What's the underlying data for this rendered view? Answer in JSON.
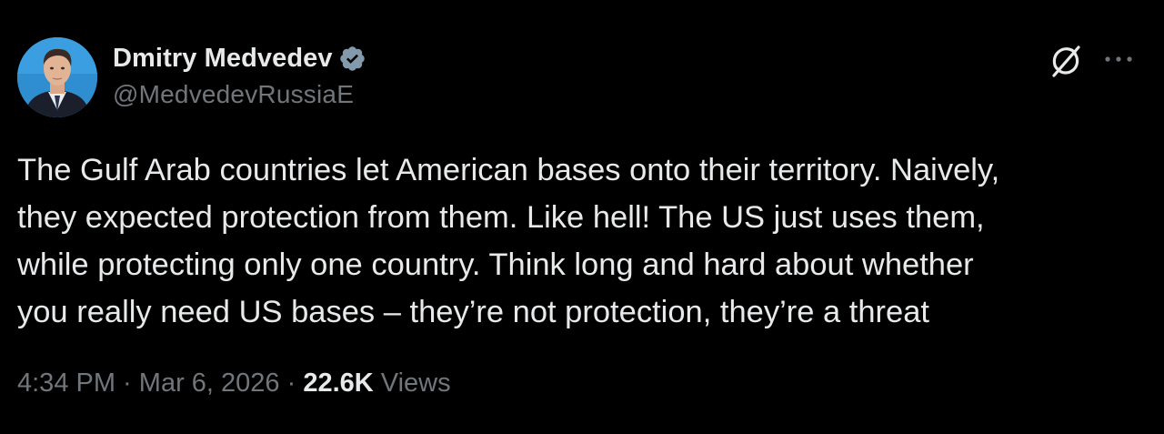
{
  "tweet": {
    "author": {
      "display_name": "Dmitry Medvedev",
      "handle": "@MedvedevRussiaE",
      "verified_icon": "verified-badge-icon",
      "avatar": "profile-avatar"
    },
    "text": "The Gulf Arab countries let American bases onto their territory. Naively,\nthey expected protection from them. Like hell! The US just uses them,\nwhile protecting only one country. Think long and hard about whether\nyou really need US bases – they’re not protection, they’re a threat",
    "timestamp": {
      "time": "4:34 PM",
      "separator1": " · ",
      "date": "Mar 6, 2026",
      "separator2": " · ",
      "views_count": "22.6K",
      "views_label": " Views"
    },
    "actions": {
      "grok_icon": "grok-icon",
      "more_icon": "more-options-icon"
    }
  },
  "colors": {
    "background": "#000000",
    "primary_text": "#e7e9ea",
    "secondary_text": "#71767b",
    "verified_badge": "#829aab"
  }
}
